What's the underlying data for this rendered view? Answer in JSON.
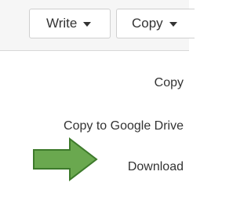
{
  "toolbar": {
    "write_label": "Write",
    "copy_label": "Copy"
  },
  "menu": {
    "items": [
      {
        "label": "Copy"
      },
      {
        "label": "Copy to Google Drive"
      },
      {
        "label": "Download"
      }
    ]
  },
  "colors": {
    "arrow_fill": "#6aa84f",
    "arrow_stroke": "#3d7a2b"
  },
  "icons": {
    "highlight": "right-arrow-icon"
  }
}
